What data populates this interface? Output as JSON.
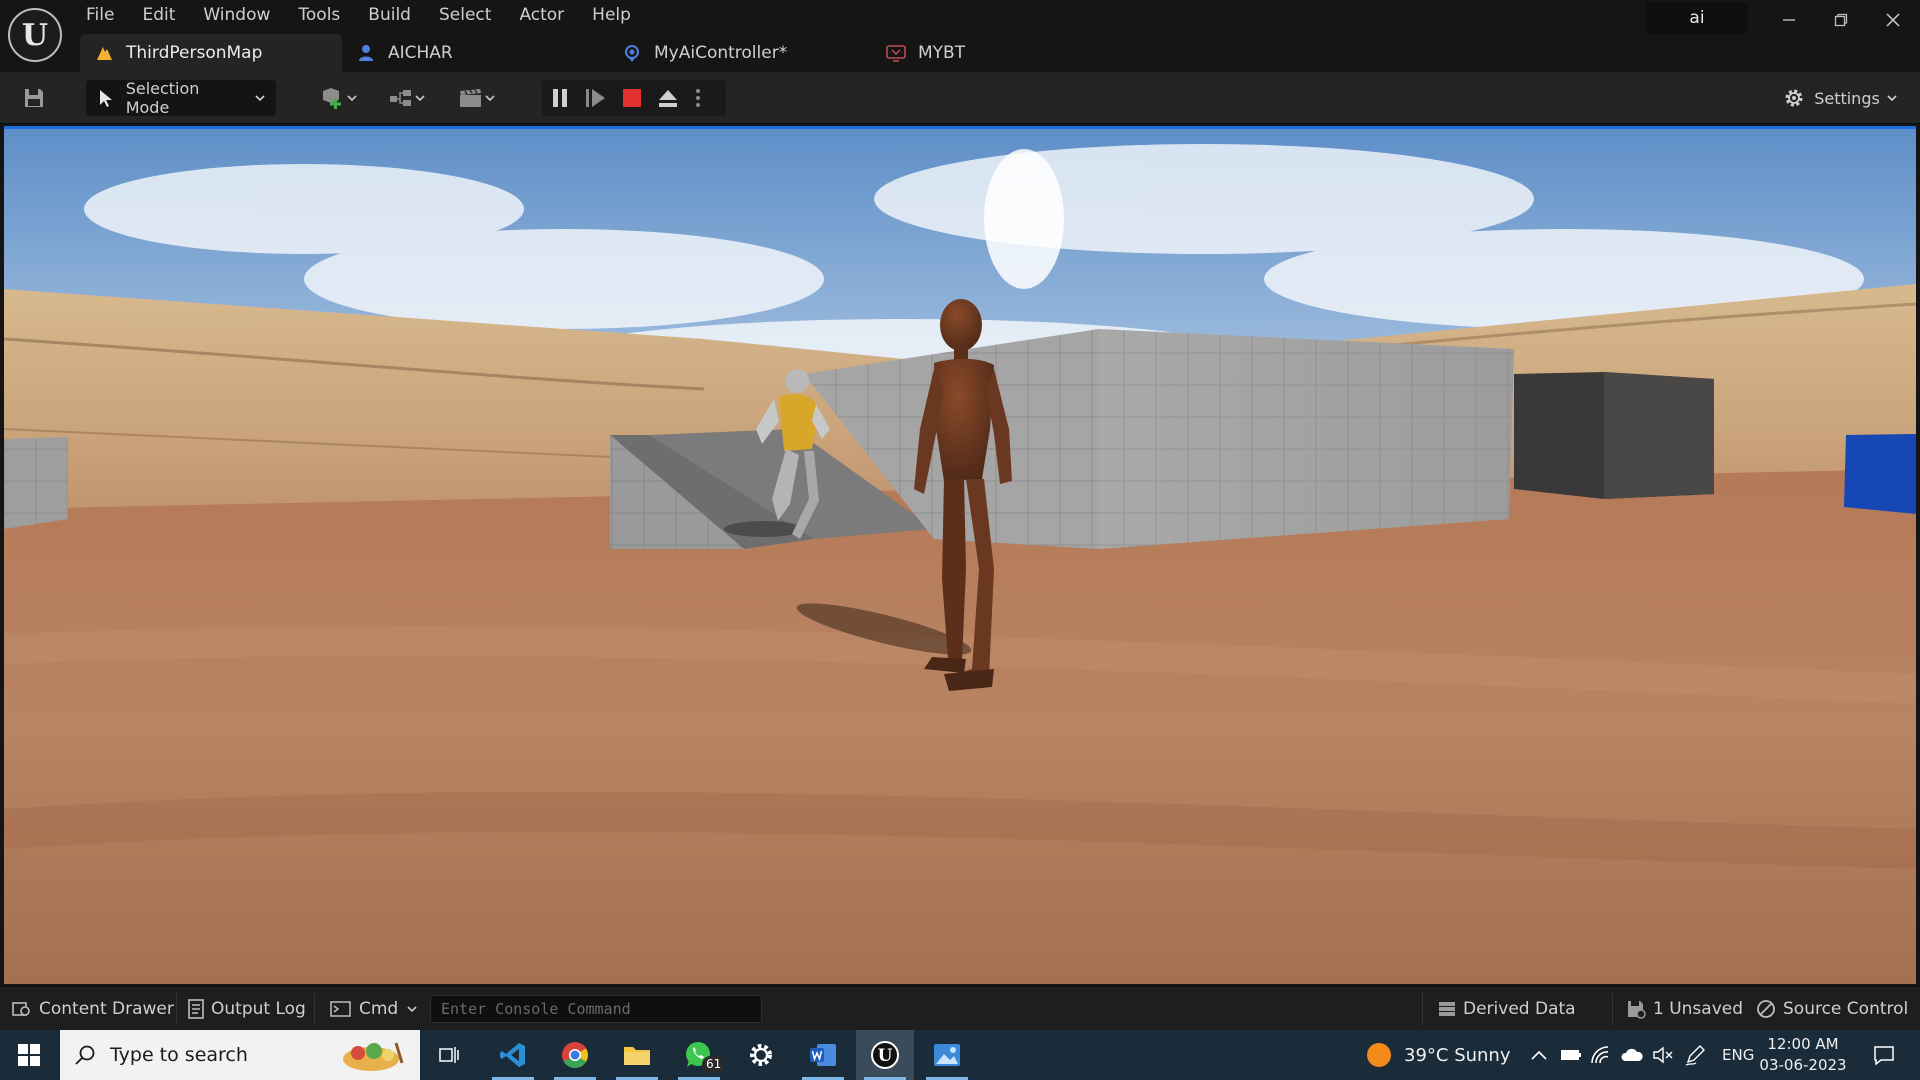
{
  "menu": [
    "File",
    "Edit",
    "Window",
    "Tools",
    "Build",
    "Select",
    "Actor",
    "Help"
  ],
  "search_value": "ai",
  "tabs": [
    {
      "label": "ThirdPersonMap",
      "icon": "level-icon"
    },
    {
      "label": "AICHAR",
      "icon": "character-icon"
    },
    {
      "label": "MyAiController*",
      "icon": "controller-icon"
    },
    {
      "label": "MYBT",
      "icon": "behavior-tree-icon"
    }
  ],
  "toolbar": {
    "selection_mode": "Selection Mode",
    "settings": "Settings"
  },
  "statusbar": {
    "content_drawer": "Content Drawer",
    "output_log": "Output Log",
    "cmd": "Cmd",
    "console_placeholder": "Enter Console Command",
    "derived_data": "Derived Data",
    "unsaved": "1 Unsaved",
    "source_control": "Source Control"
  },
  "taskbar": {
    "search_placeholder": "Type to search",
    "whatsapp_badge": "61",
    "weather": "39°C  Sunny",
    "language": "ENG",
    "time": "12:00 AM",
    "date": "03-06-2023"
  },
  "colors": {
    "accent": "#1f6fe0",
    "play_stop": "#e0312f"
  }
}
